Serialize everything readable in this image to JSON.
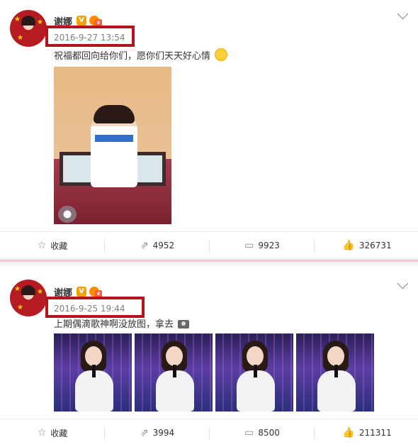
{
  "posts": [
    {
      "author": "谢娜",
      "badge_v": "V",
      "time": "2016-9-27 13:54",
      "text": "祝福都回向给你们，愿你们天天好心情",
      "emoji_name": "sun-smile-icon",
      "actions": {
        "favorite": "收藏",
        "repost": "4952",
        "comment": "9923",
        "like": "326731"
      }
    },
    {
      "author": "谢娜",
      "badge_v": "V",
      "time": "2016-9-25 19:44",
      "text": "上期偶滴歌神啊没放图，拿去",
      "emoji_name": "camera-icon",
      "actions": {
        "favorite": "收藏",
        "repost": "3994",
        "comment": "8500",
        "like": "211311"
      }
    }
  ],
  "colors": {
    "highlight_box": "#b4141c",
    "separator": "#f4c6d6",
    "badge_v": "#f3a100",
    "text": "#333333",
    "muted": "#808080"
  },
  "icons": {
    "favorite": "star-icon",
    "repost": "share-icon",
    "comment": "comment-icon",
    "like": "thumbs-up-icon",
    "menu": "chevron-down-icon"
  }
}
